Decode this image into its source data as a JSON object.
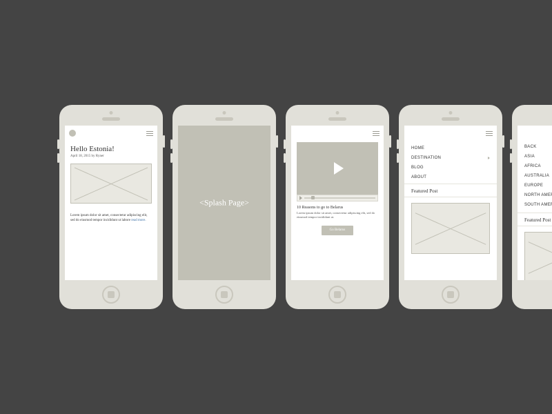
{
  "screens": {
    "article": {
      "title": "Hello Estonia!",
      "meta": "April 18, 2015 by Ryner",
      "body": "Lorem ipsum dolor sit amet, consectetur adipiscing elit, sed do eiusmod tempor incididunt ut labore",
      "read_more": "read more."
    },
    "splash": {
      "label": "<Splash Page>"
    },
    "video": {
      "title": "10 Reasons to go to Belarus",
      "body": "Lorem ipsum dolor sit amet, consectetur adipiscing elit, sed do eiusmod tempor incididunt ut.",
      "cta": "Go Belarus"
    },
    "menu_main": {
      "items": [
        "HOME",
        "DESTINATION",
        "BLOG",
        "ABOUT"
      ],
      "expandable_index": 1,
      "section_title": "Featured Post"
    },
    "menu_dest": {
      "items": [
        "BACK",
        "ASIA",
        "AFRICA",
        "AUSTRALIA",
        "EUROPE",
        "NORTH AMERICA",
        "SOUTH AMERICA"
      ],
      "section_title": "Featured Post"
    }
  }
}
